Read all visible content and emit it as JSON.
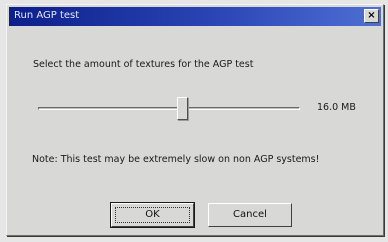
{
  "window": {
    "title": "Run AGP test",
    "close_label": "×"
  },
  "prompt": "Select the amount of textures for the AGP test",
  "slider": {
    "value_label": "16.0 MB",
    "level": 0.55
  },
  "note": "Note: This test may be extremely slow on non AGP systems!",
  "buttons": {
    "ok_label": "OK",
    "cancel_label": "Cancel"
  },
  "colors": {
    "titlebar_start": "#0c1f8a",
    "titlebar_end": "#4e6fd4",
    "face": "#d8d8d6"
  }
}
